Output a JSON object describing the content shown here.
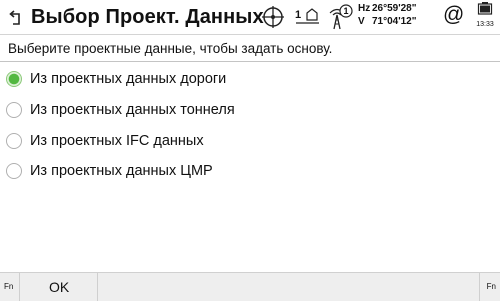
{
  "header": {
    "title": "Выбор Проект. Данных",
    "level_label": "1",
    "satellite_count": "1",
    "hz_label": "Hz",
    "hz_value": "26°59'28\"",
    "v_label": "V",
    "v_value": "71°04'12\"",
    "time": "13:33",
    "icons": [
      "back-icon",
      "level-target-icon",
      "prism-icon",
      "satellite-tower-icon",
      "at-icon",
      "battery-icon"
    ]
  },
  "instruction": "Выберите проектные данные, чтобы задать основу.",
  "options": [
    {
      "label": "Из проектных данных дороги",
      "selected": true
    },
    {
      "label": "Из проектных данных тоннеля",
      "selected": false
    },
    {
      "label": "Из проектных IFC данных",
      "selected": false
    },
    {
      "label": "Из проектных данных ЦМР",
      "selected": false
    }
  ],
  "bottom": {
    "fn_left": "Fn",
    "ok_label": "OK",
    "fn_right": "Fn"
  },
  "colors": {
    "selected_radio": "#52b840",
    "bottom_bar": "#eeeeee"
  }
}
